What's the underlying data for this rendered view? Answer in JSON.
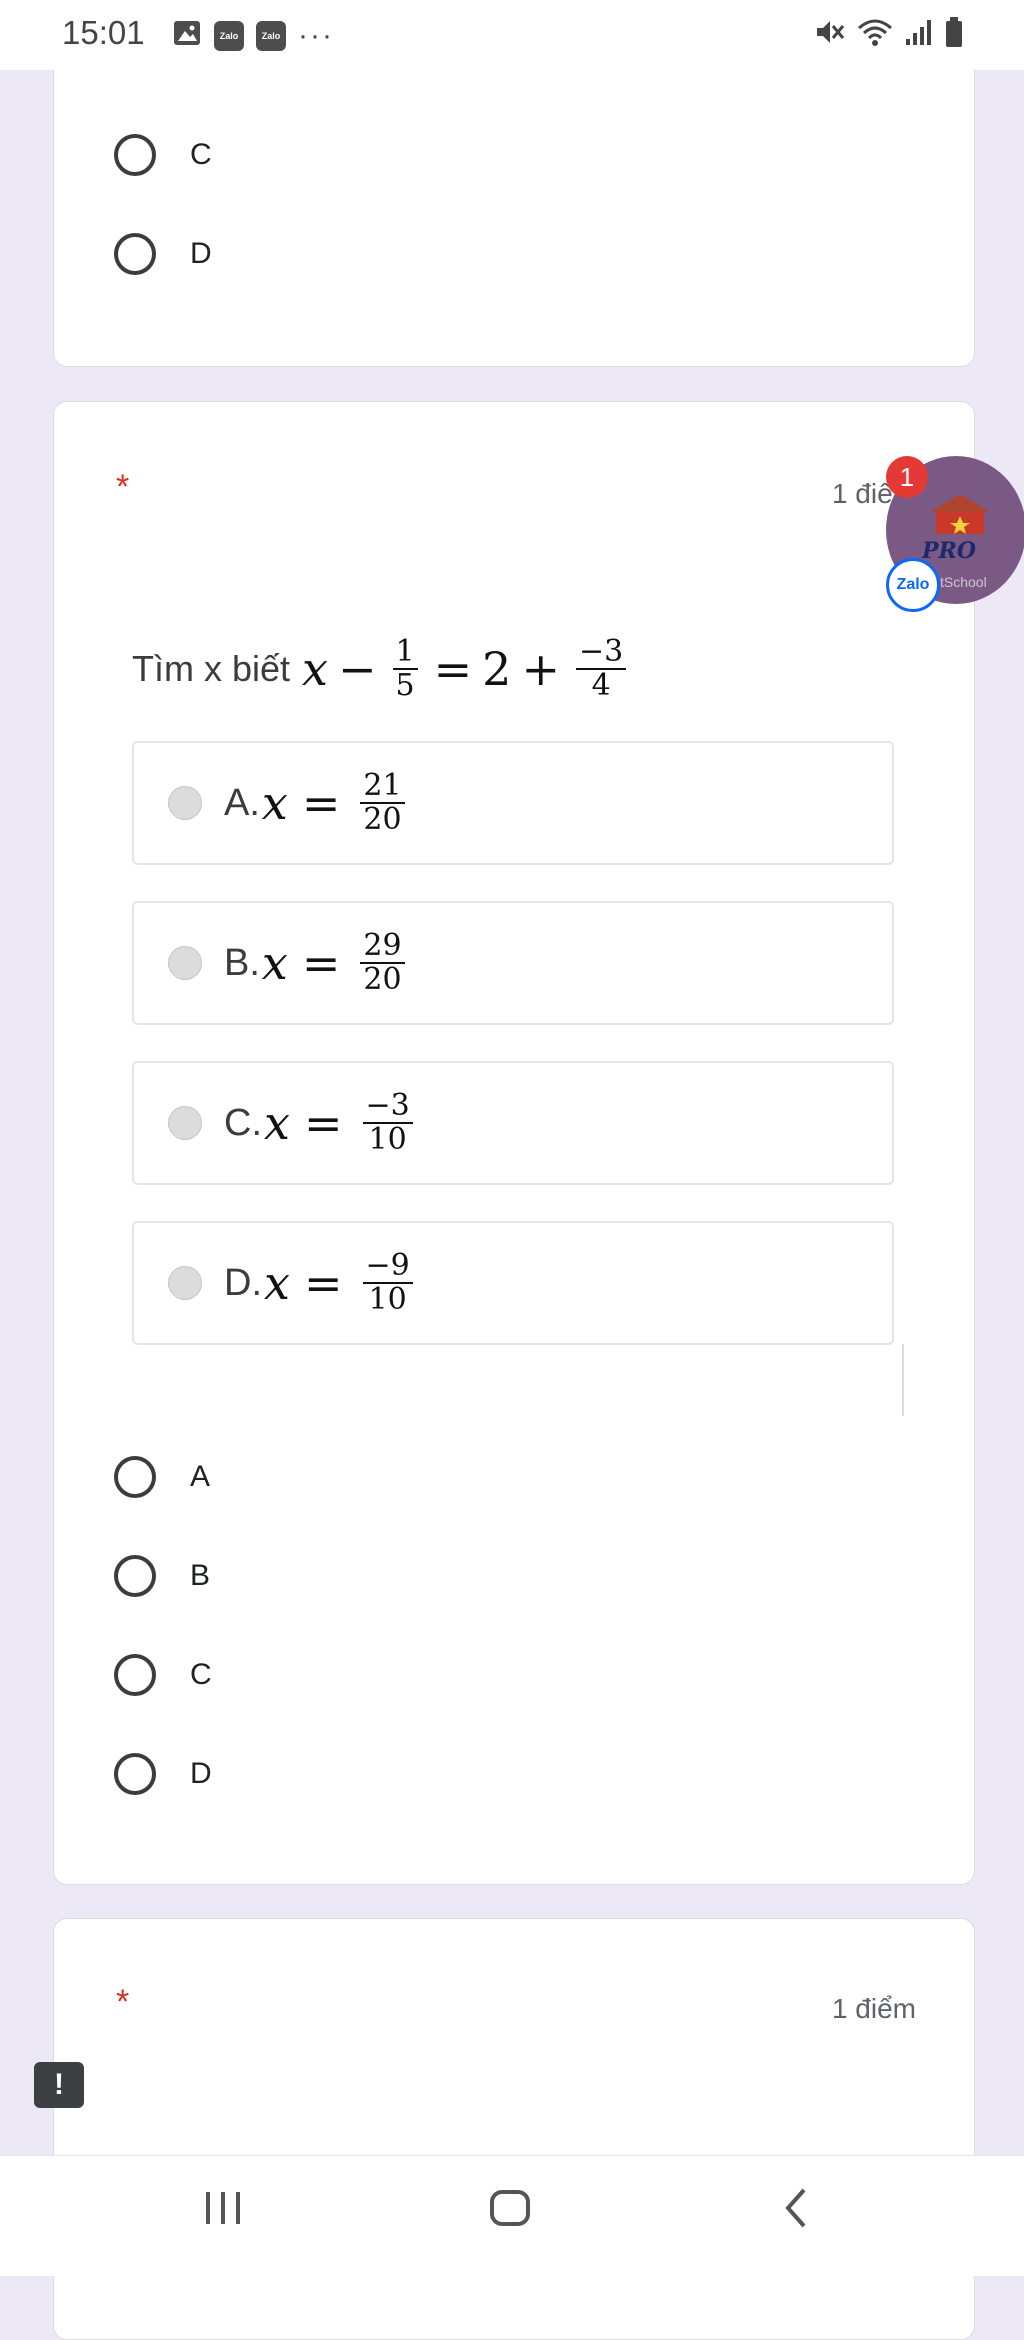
{
  "status_bar": {
    "time": "15:01",
    "notification_icons": [
      "image-icon",
      "zalo-icon",
      "zalo-icon"
    ],
    "zalo_label": "Zalo",
    "more": "···",
    "right_icons": [
      "mute-icon",
      "wifi-icon",
      "signal-icon",
      "battery-icon"
    ]
  },
  "previous_question": {
    "options": [
      {
        "label": "C"
      },
      {
        "label": "D"
      }
    ]
  },
  "question": {
    "required_mark": "*",
    "points": "1 điểm",
    "text": "Tìm x biết",
    "expression": {
      "var": "x",
      "minus": "−",
      "frac1": {
        "num": "1",
        "den": "5"
      },
      "equals": "=",
      "two": "2",
      "plus": "+",
      "frac2": {
        "num": "−3",
        "den": "4"
      }
    },
    "choices": [
      {
        "prefix": "A.",
        "var": "x",
        "eq": "=",
        "num": "21",
        "den": "20"
      },
      {
        "prefix": "B.",
        "var": "x",
        "eq": "=",
        "num": "29",
        "den": "20"
      },
      {
        "prefix": "C.",
        "var": "x",
        "eq": "=",
        "num": "−3",
        "den": "10"
      },
      {
        "prefix": "D.",
        "var": "x",
        "eq": "=",
        "num": "−9",
        "den": "10"
      }
    ],
    "answer_options": [
      {
        "label": "A"
      },
      {
        "label": "B"
      },
      {
        "label": "C"
      },
      {
        "label": "D"
      }
    ]
  },
  "next_question": {
    "required_mark": "*",
    "points": "1 điểm"
  },
  "chat_bubble": {
    "badge_count": "1",
    "brand": "PRO",
    "subtitle": "tSchool",
    "zalo_label": "Zalo"
  },
  "feedback_button": {
    "label": "!"
  },
  "nav_bar": {
    "icons": [
      "recent-apps-icon",
      "home-icon",
      "back-icon"
    ]
  }
}
